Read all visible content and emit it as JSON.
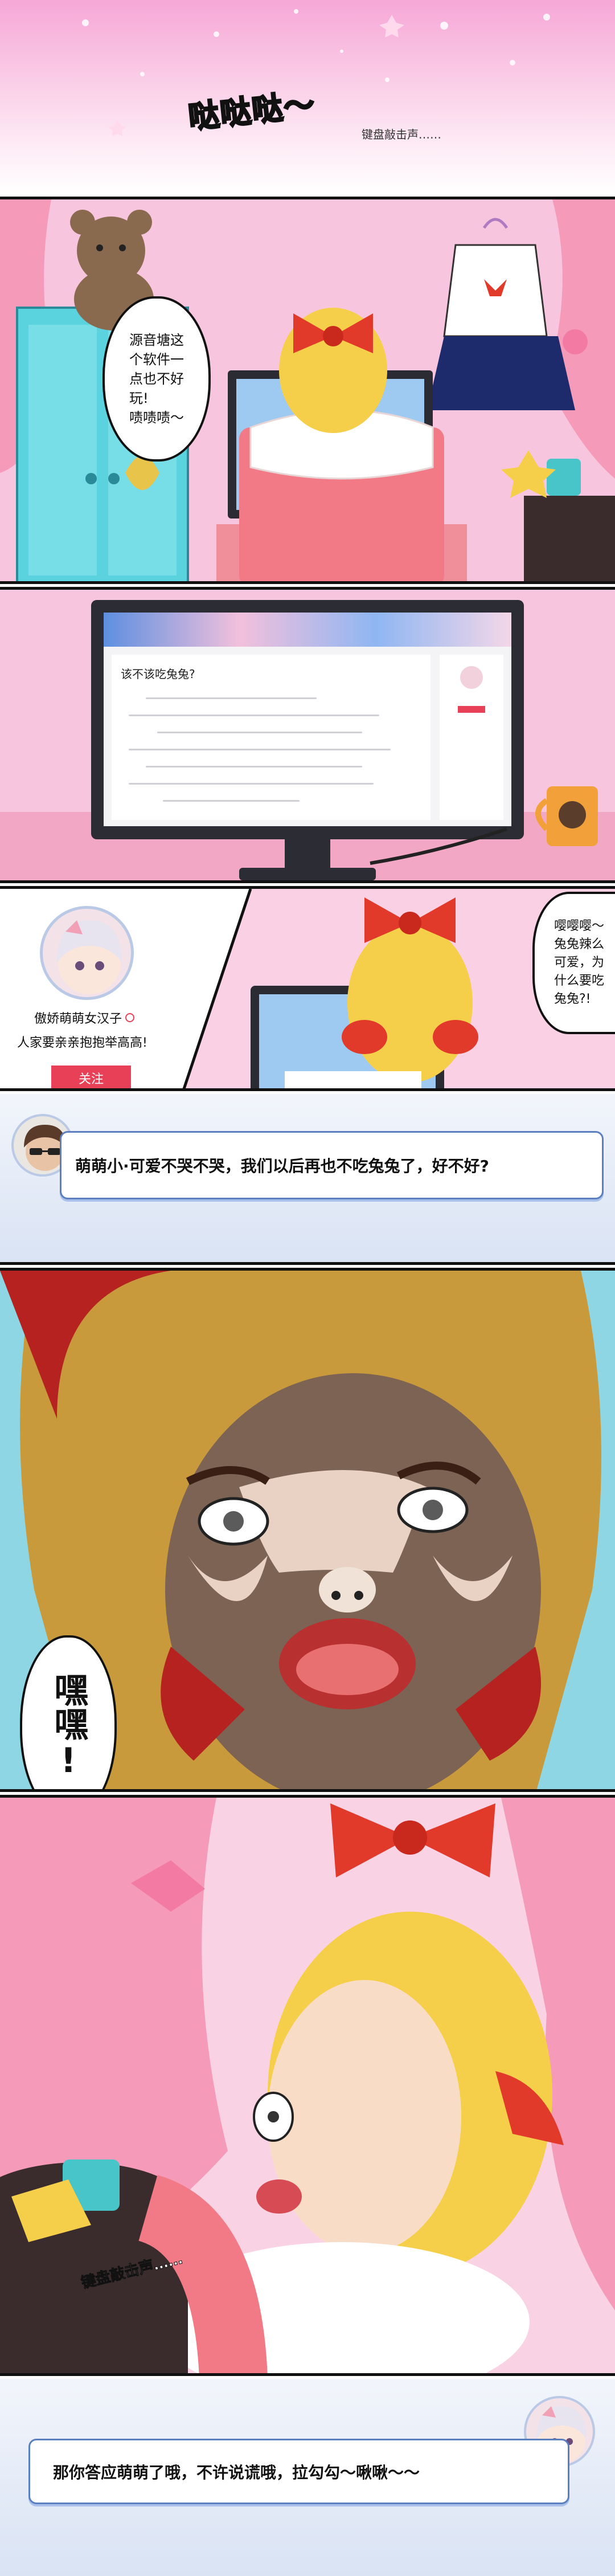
{
  "panels": {
    "p1": {
      "sfx": "哒哒哒～",
      "caption": "键盘敲击声……"
    },
    "p2": {
      "bubble_lines": [
        "源音塘这",
        "个软件一",
        "点也不好",
        "玩!",
        "啧啧啧～"
      ]
    },
    "p3": {
      "question": "该不该吃兔兔?"
    },
    "p4": {
      "profile_name": "傲娇萌萌女汉子",
      "profile_bio": "人家要亲亲抱抱举高高!",
      "follow_label": "关注",
      "bubble_lines": [
        "嘤嘤嘤～",
        "兔兔辣么",
        "可爱，为",
        "什么要吃",
        "兔兔?!"
      ]
    },
    "p5": {
      "message": "萌萌小·可爱不哭不哭，我们以后再也不吃兔兔了，好不好?"
    },
    "p6": {
      "bubble": "嘿嘿!"
    },
    "p7": {
      "caption": "键盘敲击声……"
    },
    "p8": {
      "message": "那你答应萌萌了哦，不许说谎哦，拉勾勾～啾啾～～"
    }
  },
  "colors": {
    "pink_bg": "#f7b3d6",
    "curtain": "#f59ab8",
    "desk": "#f08e9a",
    "hair": "#f5cf4a",
    "bow": "#e13a2b",
    "chat_border": "#5b7fbf",
    "follow_button": "#e84057"
  }
}
